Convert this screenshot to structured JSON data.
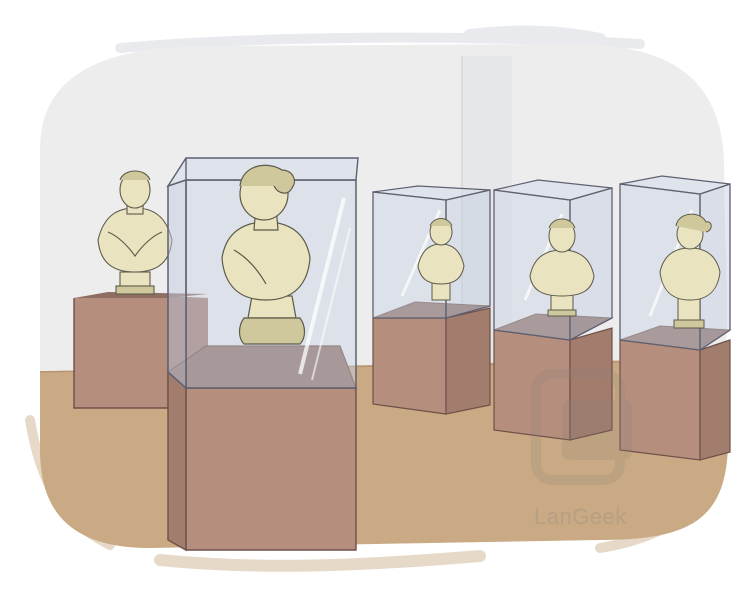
{
  "scene": {
    "description_type": "illustration",
    "colors": {
      "wall": "#ededee",
      "wall_shadow": "#e4e5e7",
      "floor": "#c9aa85",
      "pedestal_front": "#b58e7e",
      "pedestal_side": "#a27d6e",
      "pedestal_top": "#8f6e62",
      "glass": "#c9d3e4",
      "glass_edge": "#5f6070",
      "bust": "#e9e3bf",
      "bust_shade": "#cfc89d",
      "bust_line": "#5c5a4a"
    }
  },
  "watermark": {
    "text": "LanGeek"
  }
}
